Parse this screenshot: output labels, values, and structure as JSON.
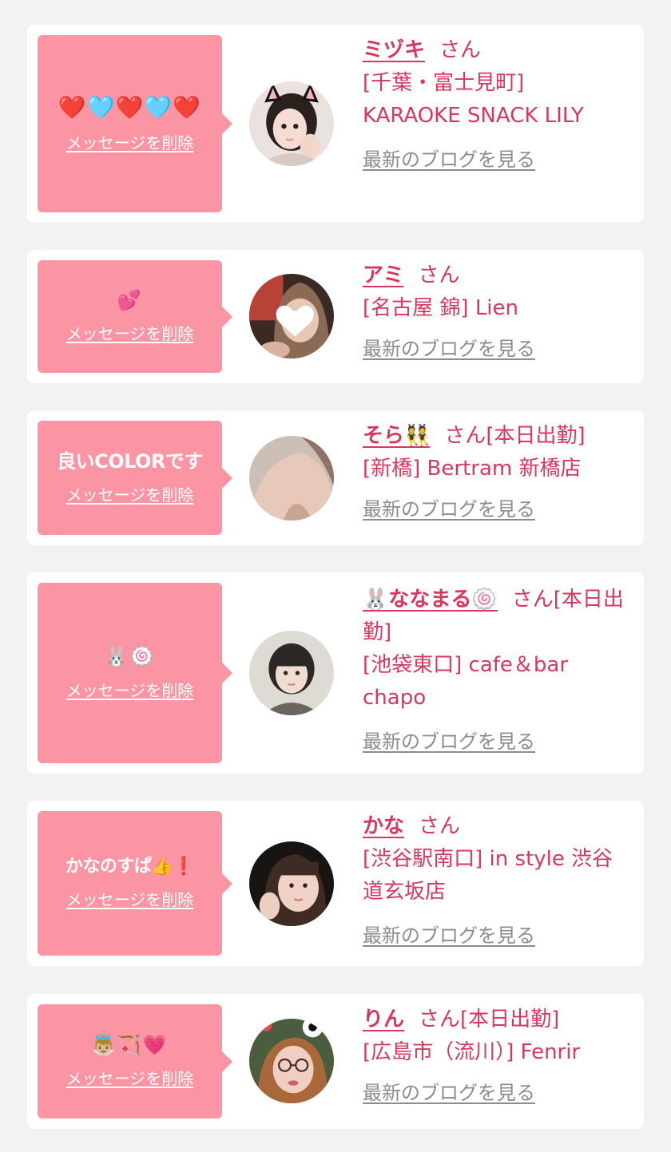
{
  "delete_label": "メッセージを削除",
  "blog_label": "最新のブログを見る",
  "san_label": "さん",
  "colors": {
    "background": "#f2f2f2",
    "card": "#ffffff",
    "bubble": "#fb95a4",
    "accent_text": "#d9375d",
    "link_gray": "#8c8c8c"
  },
  "entries": [
    {
      "message": "❤️🩵❤️🩵❤️",
      "name": "ミヅキ",
      "suffix": "さん",
      "shop": "[千葉・富士見町] KARAOKE SNACK LILY",
      "avatar_icon": "cat-ear-girl-avatar"
    },
    {
      "message": "💕",
      "name": "アミ",
      "suffix": "さん",
      "shop": "[名古屋 錦] Lien",
      "avatar_icon": "heart-covered-face-avatar"
    },
    {
      "message": "良いCOLORです",
      "name": "そら👯",
      "suffix": "さん[本日出勤]",
      "shop": "[新橋] Bertram 新橋店",
      "avatar_icon": "shoulder-photo-avatar"
    },
    {
      "message": "🐰🍥",
      "name": "🐰ななまる🍥",
      "suffix": "さん[本日出勤]",
      "shop": "[池袋東口] cafe＆bar chapo",
      "avatar_icon": "short-hair-girl-avatar"
    },
    {
      "message": "かなのすぱ👍❗️",
      "name": "かな",
      "suffix": "さん",
      "shop": "[渋谷駅南口] in style 渋谷道玄坂店",
      "avatar_icon": "selfie-girl-avatar"
    },
    {
      "message": "👼🏼🏹💗",
      "name": "りん",
      "suffix": "さん[本日出勤]",
      "shop": "[広島市（流川）] Fenrir",
      "avatar_icon": "glasses-girl-avatar"
    }
  ]
}
